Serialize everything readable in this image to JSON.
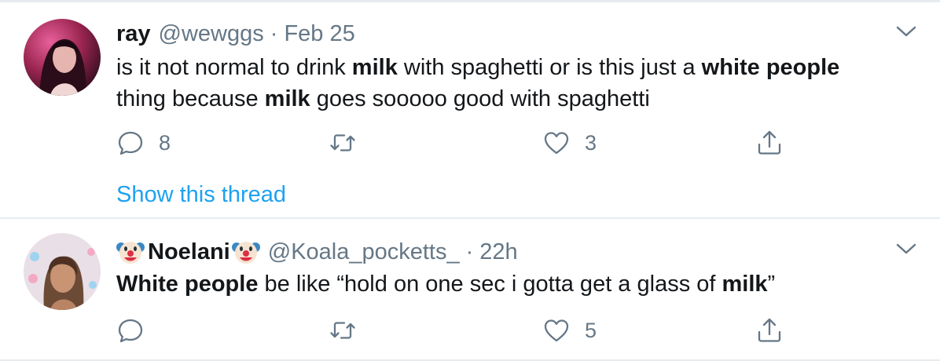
{
  "tweets": [
    {
      "name": "ray",
      "handle": "@wewggs",
      "dot": "·",
      "time": "Feb 25",
      "body_segments": [
        {
          "text": "is it not normal to drink ",
          "bold": false
        },
        {
          "text": "milk",
          "bold": true
        },
        {
          "text": " with spaghetti or is this just a ",
          "bold": false
        },
        {
          "text": "white people",
          "bold": true
        },
        {
          "text": " thing because ",
          "bold": false
        },
        {
          "text": "milk",
          "bold": true
        },
        {
          "text": " goes sooooo good with spaghetti",
          "bold": false
        }
      ],
      "reply_count": "8",
      "retweet_count": "",
      "like_count": "3",
      "show_thread": "Show this thread"
    },
    {
      "name": "Noelani",
      "handle": "@Koala_pocketts_",
      "dot": "·",
      "time": "22h",
      "name_emoji": "clown-face-icon",
      "body_segments": [
        {
          "text": "White people",
          "bold": true
        },
        {
          "text": " be like “hold on one sec i gotta get a glass of ",
          "bold": false
        },
        {
          "text": "milk",
          "bold": true
        },
        {
          "text": "”",
          "bold": false
        }
      ],
      "reply_count": "",
      "retweet_count": "",
      "like_count": "5"
    }
  ],
  "colors": {
    "text": "#14171a",
    "secondary": "#657786",
    "link": "#1da1f2",
    "divider": "#e6ecf0"
  }
}
